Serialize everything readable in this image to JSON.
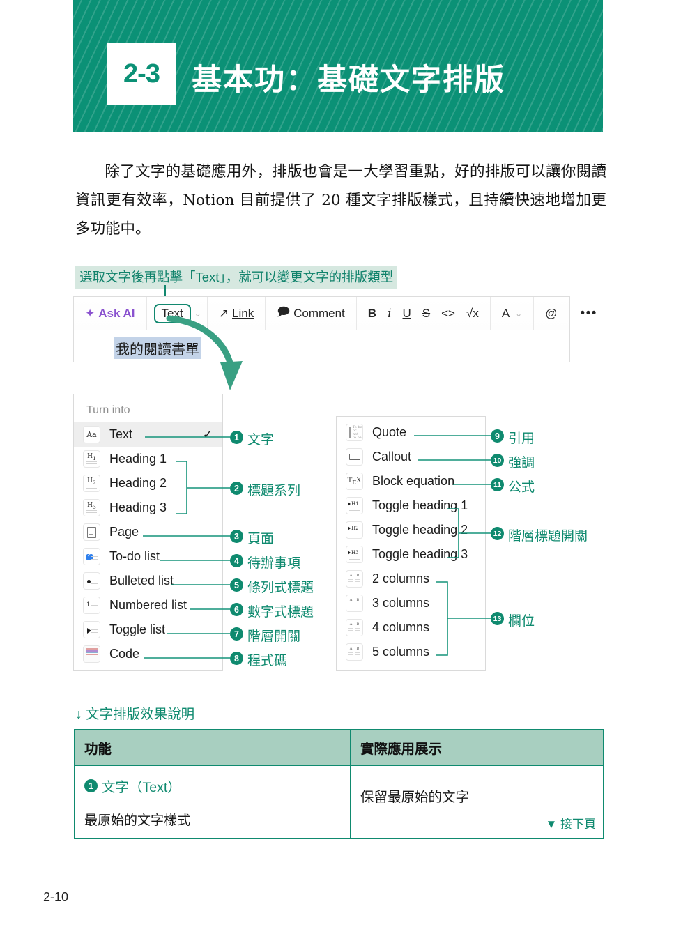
{
  "header": {
    "chapter_number": "2-3",
    "title": "基本功：基礎文字排版",
    "banner_color": "#0b9176"
  },
  "intro_paragraph": "除了文字的基礎應用外，排版也會是一大學習重點，好的排版可以讓你閱讀資訊更有效率，Notion 目前提供了 20 種文字排版樣式，且持續快速地增加更多功能中。",
  "screenshot": {
    "caption": "選取文字後再點擊「Text」，就可以變更文字的排版類型",
    "toolbar": {
      "ask_ai": "Ask AI",
      "sparkle_icon": "✦",
      "text_dropdown": "Text",
      "chevron": "⌄",
      "link_icon": "↗",
      "link": "Link",
      "comment_icon": "🗩",
      "comment": "Comment",
      "bold": "B",
      "italic": "i",
      "underline": "U",
      "strikethrough": "S",
      "code": "<>",
      "equation": "√x",
      "color": "A",
      "mention": "@",
      "more": "•••"
    },
    "selected_text": "我的閱讀書單"
  },
  "panel_left": {
    "label": "Turn into",
    "items": [
      {
        "icon": "aa-icon",
        "label": "Text",
        "selected": true,
        "check": "✓"
      },
      {
        "icon": "heading-1-icon",
        "label": "Heading 1",
        "selected": false
      },
      {
        "icon": "heading-2-icon",
        "label": "Heading 2",
        "selected": false
      },
      {
        "icon": "heading-3-icon",
        "label": "Heading 3",
        "selected": false
      },
      {
        "icon": "page-icon",
        "label": "Page",
        "selected": false
      },
      {
        "icon": "todo-list-icon",
        "label": "To-do list",
        "selected": false
      },
      {
        "icon": "bulleted-list-icon",
        "label": "Bulleted list",
        "selected": false
      },
      {
        "icon": "numbered-list-icon",
        "label": "Numbered list",
        "selected": false
      },
      {
        "icon": "toggle-list-icon",
        "label": "Toggle list",
        "selected": false
      },
      {
        "icon": "code-icon",
        "label": "Code",
        "selected": false
      }
    ]
  },
  "panel_right": {
    "items": [
      {
        "icon": "quote-icon",
        "label": "Quote"
      },
      {
        "icon": "callout-icon",
        "label": "Callout"
      },
      {
        "icon": "block-equation-icon",
        "label": "Block equation"
      },
      {
        "icon": "toggle-heading-1-icon",
        "label": "Toggle heading 1"
      },
      {
        "icon": "toggle-heading-2-icon",
        "label": "Toggle heading 2"
      },
      {
        "icon": "toggle-heading-3-icon",
        "label": "Toggle heading 3"
      },
      {
        "icon": "columns-2-icon",
        "label": "2 columns"
      },
      {
        "icon": "columns-3-icon",
        "label": "3 columns"
      },
      {
        "icon": "columns-4-icon",
        "label": "4 columns"
      },
      {
        "icon": "columns-5-icon",
        "label": "5 columns"
      }
    ]
  },
  "annotations": [
    {
      "num": "1",
      "text": "文字"
    },
    {
      "num": "2",
      "text": "標題系列"
    },
    {
      "num": "3",
      "text": "頁面"
    },
    {
      "num": "4",
      "text": "待辦事項"
    },
    {
      "num": "5",
      "text": "條列式標題"
    },
    {
      "num": "6",
      "text": "數字式標題"
    },
    {
      "num": "7",
      "text": "階層開關"
    },
    {
      "num": "8",
      "text": "程式碼"
    },
    {
      "num": "9",
      "text": "引用"
    },
    {
      "num": "10",
      "text": "強調"
    },
    {
      "num": "11",
      "text": "公式"
    },
    {
      "num": "12",
      "text": "階層標題開關"
    },
    {
      "num": "13",
      "text": "欄位"
    }
  ],
  "table": {
    "caption": "↓ 文字排版效果說明",
    "headers": [
      "功能",
      "實際應用展示"
    ],
    "rows": [
      {
        "badge": "1",
        "feature_title": "文字（Text）",
        "feature_sub": "最原始的文字樣式",
        "demo": "保留最原始的文字",
        "continued": "▼ 接下頁"
      }
    ]
  },
  "footer": {
    "page_number": "2-10"
  }
}
